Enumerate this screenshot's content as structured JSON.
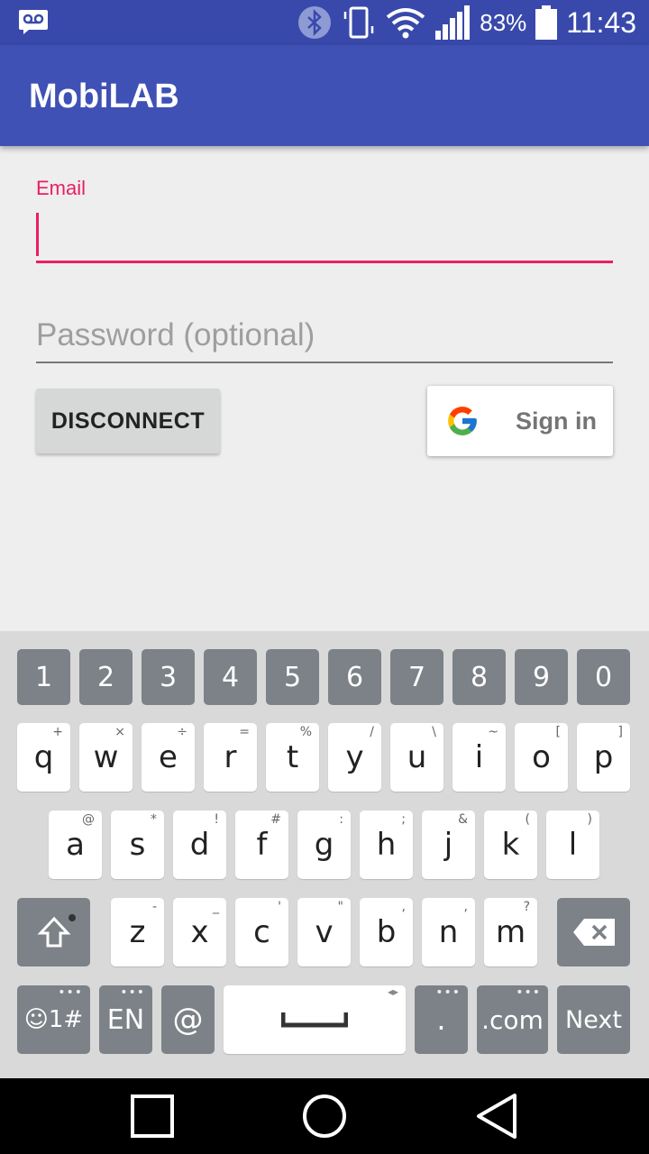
{
  "status_bar": {
    "battery_percent": "83%",
    "time": "11:43",
    "icons": [
      "voicemail-icon",
      "bluetooth-icon",
      "vibrate-icon",
      "wifi-icon",
      "signal-icon",
      "battery-icon"
    ]
  },
  "app_bar": {
    "title": "MobiLAB"
  },
  "form": {
    "email_label": "Email",
    "email_value": "",
    "password_placeholder": "Password (optional)",
    "disconnect_label": "DISCONNECT",
    "google_signin_label": "Sign in"
  },
  "keyboard": {
    "numbers": [
      "1",
      "2",
      "3",
      "4",
      "5",
      "6",
      "7",
      "8",
      "9",
      "0"
    ],
    "row1": [
      {
        "k": "q",
        "h": "+"
      },
      {
        "k": "w",
        "h": "×"
      },
      {
        "k": "e",
        "h": "÷"
      },
      {
        "k": "r",
        "h": "="
      },
      {
        "k": "t",
        "h": "%"
      },
      {
        "k": "y",
        "h": "/"
      },
      {
        "k": "u",
        "h": "\\"
      },
      {
        "k": "i",
        "h": "~"
      },
      {
        "k": "o",
        "h": "["
      },
      {
        "k": "p",
        "h": "]"
      }
    ],
    "row2": [
      {
        "k": "a",
        "h": "@"
      },
      {
        "k": "s",
        "h": "*"
      },
      {
        "k": "d",
        "h": "!"
      },
      {
        "k": "f",
        "h": "#"
      },
      {
        "k": "g",
        "h": ":"
      },
      {
        "k": "h",
        "h": ";"
      },
      {
        "k": "j",
        "h": "&"
      },
      {
        "k": "k",
        "h": "("
      },
      {
        "k": "l",
        "h": ")"
      }
    ],
    "row3": [
      {
        "k": "z",
        "h": "-"
      },
      {
        "k": "x",
        "h": "_"
      },
      {
        "k": "c",
        "h": "'"
      },
      {
        "k": "v",
        "h": "\""
      },
      {
        "k": "b",
        "h": ","
      },
      {
        "k": "n",
        "h": ","
      },
      {
        "k": "m",
        "h": "?"
      }
    ],
    "symbols_label": "☺1#",
    "language_label": "EN",
    "at_label": "@",
    "period_label": ".",
    "dotcom_label": ".com",
    "next_label": "Next"
  },
  "nav_bar": {
    "icons": [
      "recents-square-icon",
      "home-circle-icon",
      "back-triangle-icon"
    ]
  },
  "colors": {
    "status_bar": "#3949ab",
    "app_bar": "#3f51b5",
    "accent": "#e91e63",
    "key_dark": "#7c8287"
  }
}
